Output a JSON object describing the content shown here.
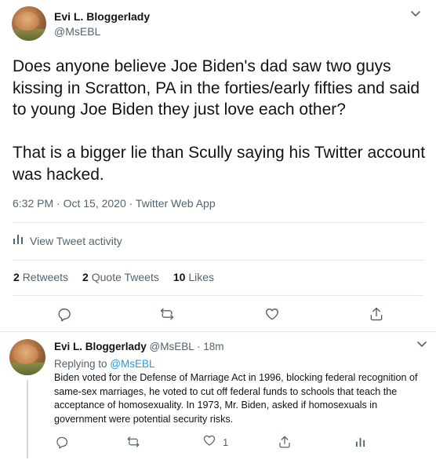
{
  "tweet": {
    "author_name": "Evi L. Bloggerlady",
    "author_handle": "@MsEBL",
    "text": "Does anyone believe Joe Biden's dad saw two guys kissing in Scratton, PA in the forties/early fifties and said to young Joe Biden they just love each other?\n\nThat is a bigger lie than Scully saying his Twitter account was hacked.",
    "timestamp": "6:32 PM · Oct 15, 2020 · Twitter Web App",
    "activity_label": "View Tweet activity",
    "stats": {
      "retweets_count": "2",
      "retweets_label": "Retweets",
      "quotes_count": "2",
      "quotes_label": "Quote Tweets",
      "likes_count": "10",
      "likes_label": "Likes"
    }
  },
  "reply": {
    "author_name": "Evi L. Bloggerlady",
    "author_handle": "@MsEBL",
    "time": "· 18m",
    "replying_prefix": "Replying to ",
    "replying_to": "@MsEBL",
    "text": "Biden voted for the Defense of Marriage Act in 1996, blocking federal recognition of same-sex marriages, he voted to cut off federal funds to schools that teach the acceptance of homosexuality. In 1973, Mr. Biden, asked if homosexuals in government were potential security risks.",
    "like_count": "1"
  },
  "icons": {
    "reply": "comment-icon",
    "retweet": "retweet-icon",
    "like": "heart-icon",
    "share": "share-icon",
    "analytics": "analytics-icon",
    "more": "chevron-down-icon"
  },
  "colors": {
    "accent": "#1d9bf0",
    "secondary_text": "#536471",
    "divider": "#e1e8ed"
  }
}
